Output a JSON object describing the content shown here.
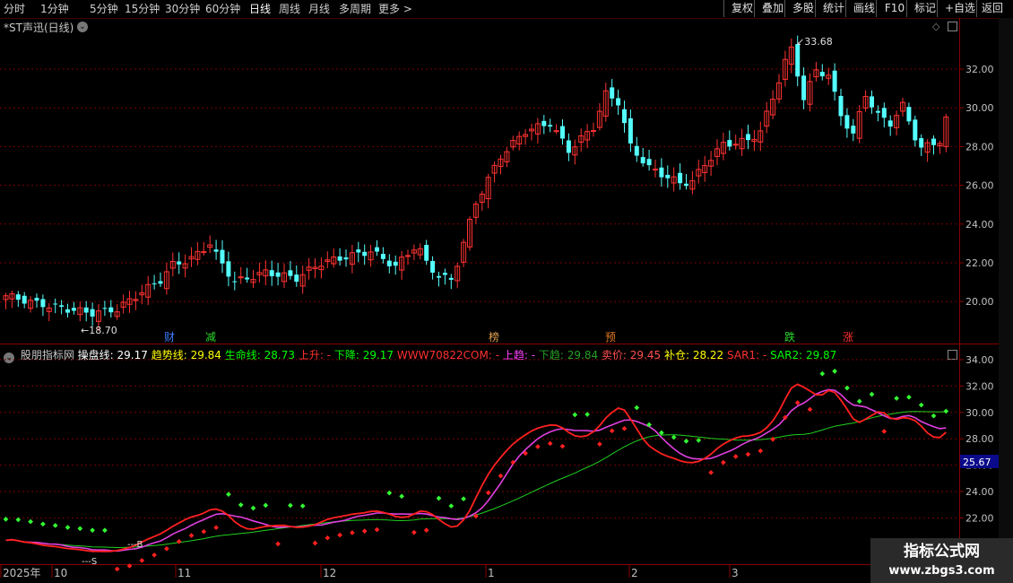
{
  "toolbar": {
    "periods": [
      "分时",
      "1分钟",
      "5分钟",
      "15分钟",
      "30分钟",
      "60分钟",
      "日线",
      "周线",
      "月线",
      "多周期",
      "更多 >"
    ],
    "active_period": "日线",
    "right_buttons": [
      "复权",
      "叠加",
      "多股",
      "统计",
      "画线",
      "F10",
      "标记",
      "+自选",
      "返回"
    ]
  },
  "main_chart": {
    "title": "*ST声迅(日线)",
    "y_ticks": [
      "32.00",
      "30.00",
      "28.00",
      "26.00",
      "24.00",
      "22.00",
      "20.00"
    ],
    "high_label": "33.68",
    "low_label": "18.70",
    "event_markers": [
      {
        "text": "财",
        "color": "#3b7bff"
      },
      {
        "text": "减",
        "color": "#2bd82b"
      },
      {
        "text": "榜",
        "color": "#e0a050"
      },
      {
        "text": "预",
        "color": "#e07a20"
      },
      {
        "text": "跌",
        "color": "#2bd82b"
      },
      {
        "text": "涨",
        "color": "#ff3030"
      }
    ]
  },
  "indicator": {
    "items": [
      {
        "text": "股朋指标网",
        "color": "#c8c8c8"
      },
      {
        "text": "操盘线: 29.17",
        "color": "#ffffff"
      },
      {
        "text": "趋势线: 29.84",
        "color": "#ffff00"
      },
      {
        "text": "生命线: 28.73",
        "color": "#00ff00"
      },
      {
        "text": "上升: -",
        "color": "#ff3030"
      },
      {
        "text": "下降: 29.17",
        "color": "#00ff00"
      },
      {
        "text": "WWW70822COM: -",
        "color": "#ff3030"
      },
      {
        "text": "上趋: -",
        "color": "#ff40ff"
      },
      {
        "text": "下趋: 29.84",
        "color": "#28a028"
      },
      {
        "text": "卖价: 29.45",
        "color": "#ff5050"
      },
      {
        "text": "补仓: 28.22",
        "color": "#ffff00"
      },
      {
        "text": "SAR1: -",
        "color": "#ff3030"
      },
      {
        "text": "SAR2: 29.87",
        "color": "#00ff00"
      }
    ],
    "y_ticks": [
      "34.00",
      "32.00",
      "30.00",
      "28.00",
      "26.00",
      "24.00",
      "22.00"
    ],
    "current_value": "25.67",
    "b_label": "B",
    "s_label": "S"
  },
  "x_axis": {
    "labels": [
      "2025年",
      "10",
      "11",
      "12",
      "1",
      "2",
      "3"
    ]
  },
  "watermark": {
    "line1": "指标公式网",
    "line2": "www.zbgs3.com"
  },
  "colors": {
    "up": "#ff3232",
    "down": "#54ffff",
    "grid": "#7a0000",
    "axis": "#8b0000"
  },
  "icons": [
    "settings-icon",
    "diamond-icon",
    "pane-toggle-icon",
    "arrow-icon"
  ]
}
